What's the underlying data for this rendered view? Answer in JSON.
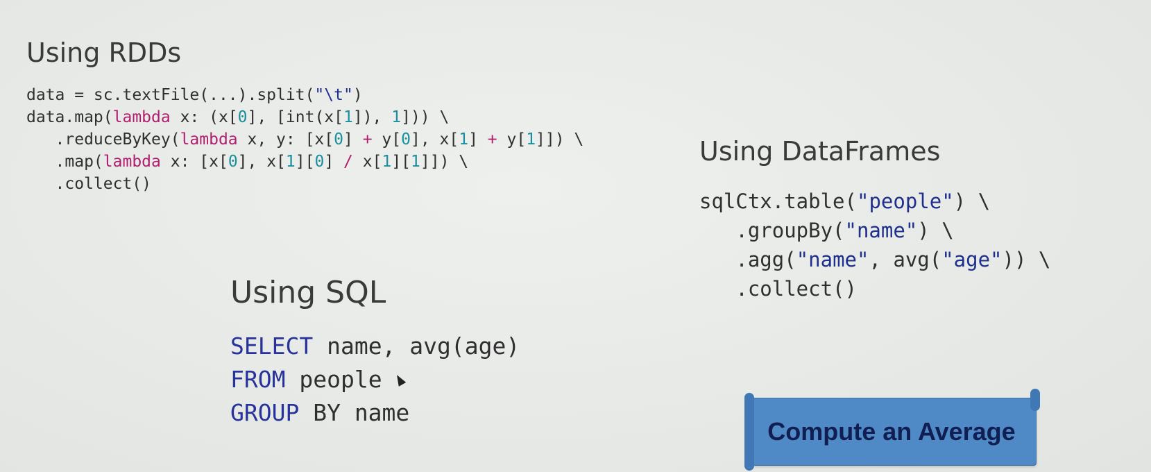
{
  "rdd": {
    "title": "Using RDDs",
    "code": [
      [
        {
          "t": "data = sc.textFile(...).split(",
          "c": ""
        },
        {
          "t": "\"\\t\"",
          "c": "str"
        },
        {
          "t": ")",
          "c": ""
        }
      ],
      [
        {
          "t": "data.map(",
          "c": ""
        },
        {
          "t": "lambda",
          "c": "kw"
        },
        {
          "t": " x: (x[",
          "c": ""
        },
        {
          "t": "0",
          "c": "num"
        },
        {
          "t": "], [int(x[",
          "c": ""
        },
        {
          "t": "1",
          "c": "num"
        },
        {
          "t": "]), ",
          "c": ""
        },
        {
          "t": "1",
          "c": "num"
        },
        {
          "t": "])) \\",
          "c": ""
        }
      ],
      [
        {
          "t": "   .reduceByKey(",
          "c": ""
        },
        {
          "t": "lambda",
          "c": "kw"
        },
        {
          "t": " x, y: [x[",
          "c": ""
        },
        {
          "t": "0",
          "c": "num"
        },
        {
          "t": "] ",
          "c": ""
        },
        {
          "t": "+",
          "c": "kw"
        },
        {
          "t": " y[",
          "c": ""
        },
        {
          "t": "0",
          "c": "num"
        },
        {
          "t": "], x[",
          "c": ""
        },
        {
          "t": "1",
          "c": "num"
        },
        {
          "t": "] ",
          "c": ""
        },
        {
          "t": "+",
          "c": "kw"
        },
        {
          "t": " y[",
          "c": ""
        },
        {
          "t": "1",
          "c": "num"
        },
        {
          "t": "]]) \\",
          "c": ""
        }
      ],
      [
        {
          "t": "   .map(",
          "c": ""
        },
        {
          "t": "lambda",
          "c": "kw"
        },
        {
          "t": " x: [x[",
          "c": ""
        },
        {
          "t": "0",
          "c": "num"
        },
        {
          "t": "], x[",
          "c": ""
        },
        {
          "t": "1",
          "c": "num"
        },
        {
          "t": "][",
          "c": ""
        },
        {
          "t": "0",
          "c": "num"
        },
        {
          "t": "] ",
          "c": ""
        },
        {
          "t": "/",
          "c": "kw"
        },
        {
          "t": " x[",
          "c": ""
        },
        {
          "t": "1",
          "c": "num"
        },
        {
          "t": "][",
          "c": ""
        },
        {
          "t": "1",
          "c": "num"
        },
        {
          "t": "]]) \\",
          "c": ""
        }
      ],
      [
        {
          "t": "   .collect()",
          "c": ""
        }
      ]
    ]
  },
  "dataframes": {
    "title": "Using DataFrames",
    "code": [
      [
        {
          "t": "sqlCtx.table(",
          "c": ""
        },
        {
          "t": "\"people\"",
          "c": "str"
        },
        {
          "t": ") \\",
          "c": ""
        }
      ],
      [
        {
          "t": "   .groupBy(",
          "c": ""
        },
        {
          "t": "\"name\"",
          "c": "str"
        },
        {
          "t": ") \\",
          "c": ""
        }
      ],
      [
        {
          "t": "   .agg(",
          "c": ""
        },
        {
          "t": "\"name\"",
          "c": "str"
        },
        {
          "t": ", avg(",
          "c": ""
        },
        {
          "t": "\"age\"",
          "c": "str"
        },
        {
          "t": ")) \\",
          "c": ""
        }
      ],
      [
        {
          "t": "   .collect()",
          "c": ""
        }
      ]
    ]
  },
  "sql": {
    "title": "Using SQL",
    "code": [
      [
        {
          "t": "SELECT",
          "c": "sqlkw"
        },
        {
          "t": " name, avg(age)",
          "c": ""
        }
      ],
      [
        {
          "t": "FROM",
          "c": "sqlkw"
        },
        {
          "t": " people",
          "c": ""
        }
      ],
      [
        {
          "t": "GROUP",
          "c": "sqlkw"
        },
        {
          "t": " BY name",
          "c": ""
        }
      ]
    ]
  },
  "banner": {
    "label": "Compute an Average",
    "color": "#4f8ac6"
  }
}
